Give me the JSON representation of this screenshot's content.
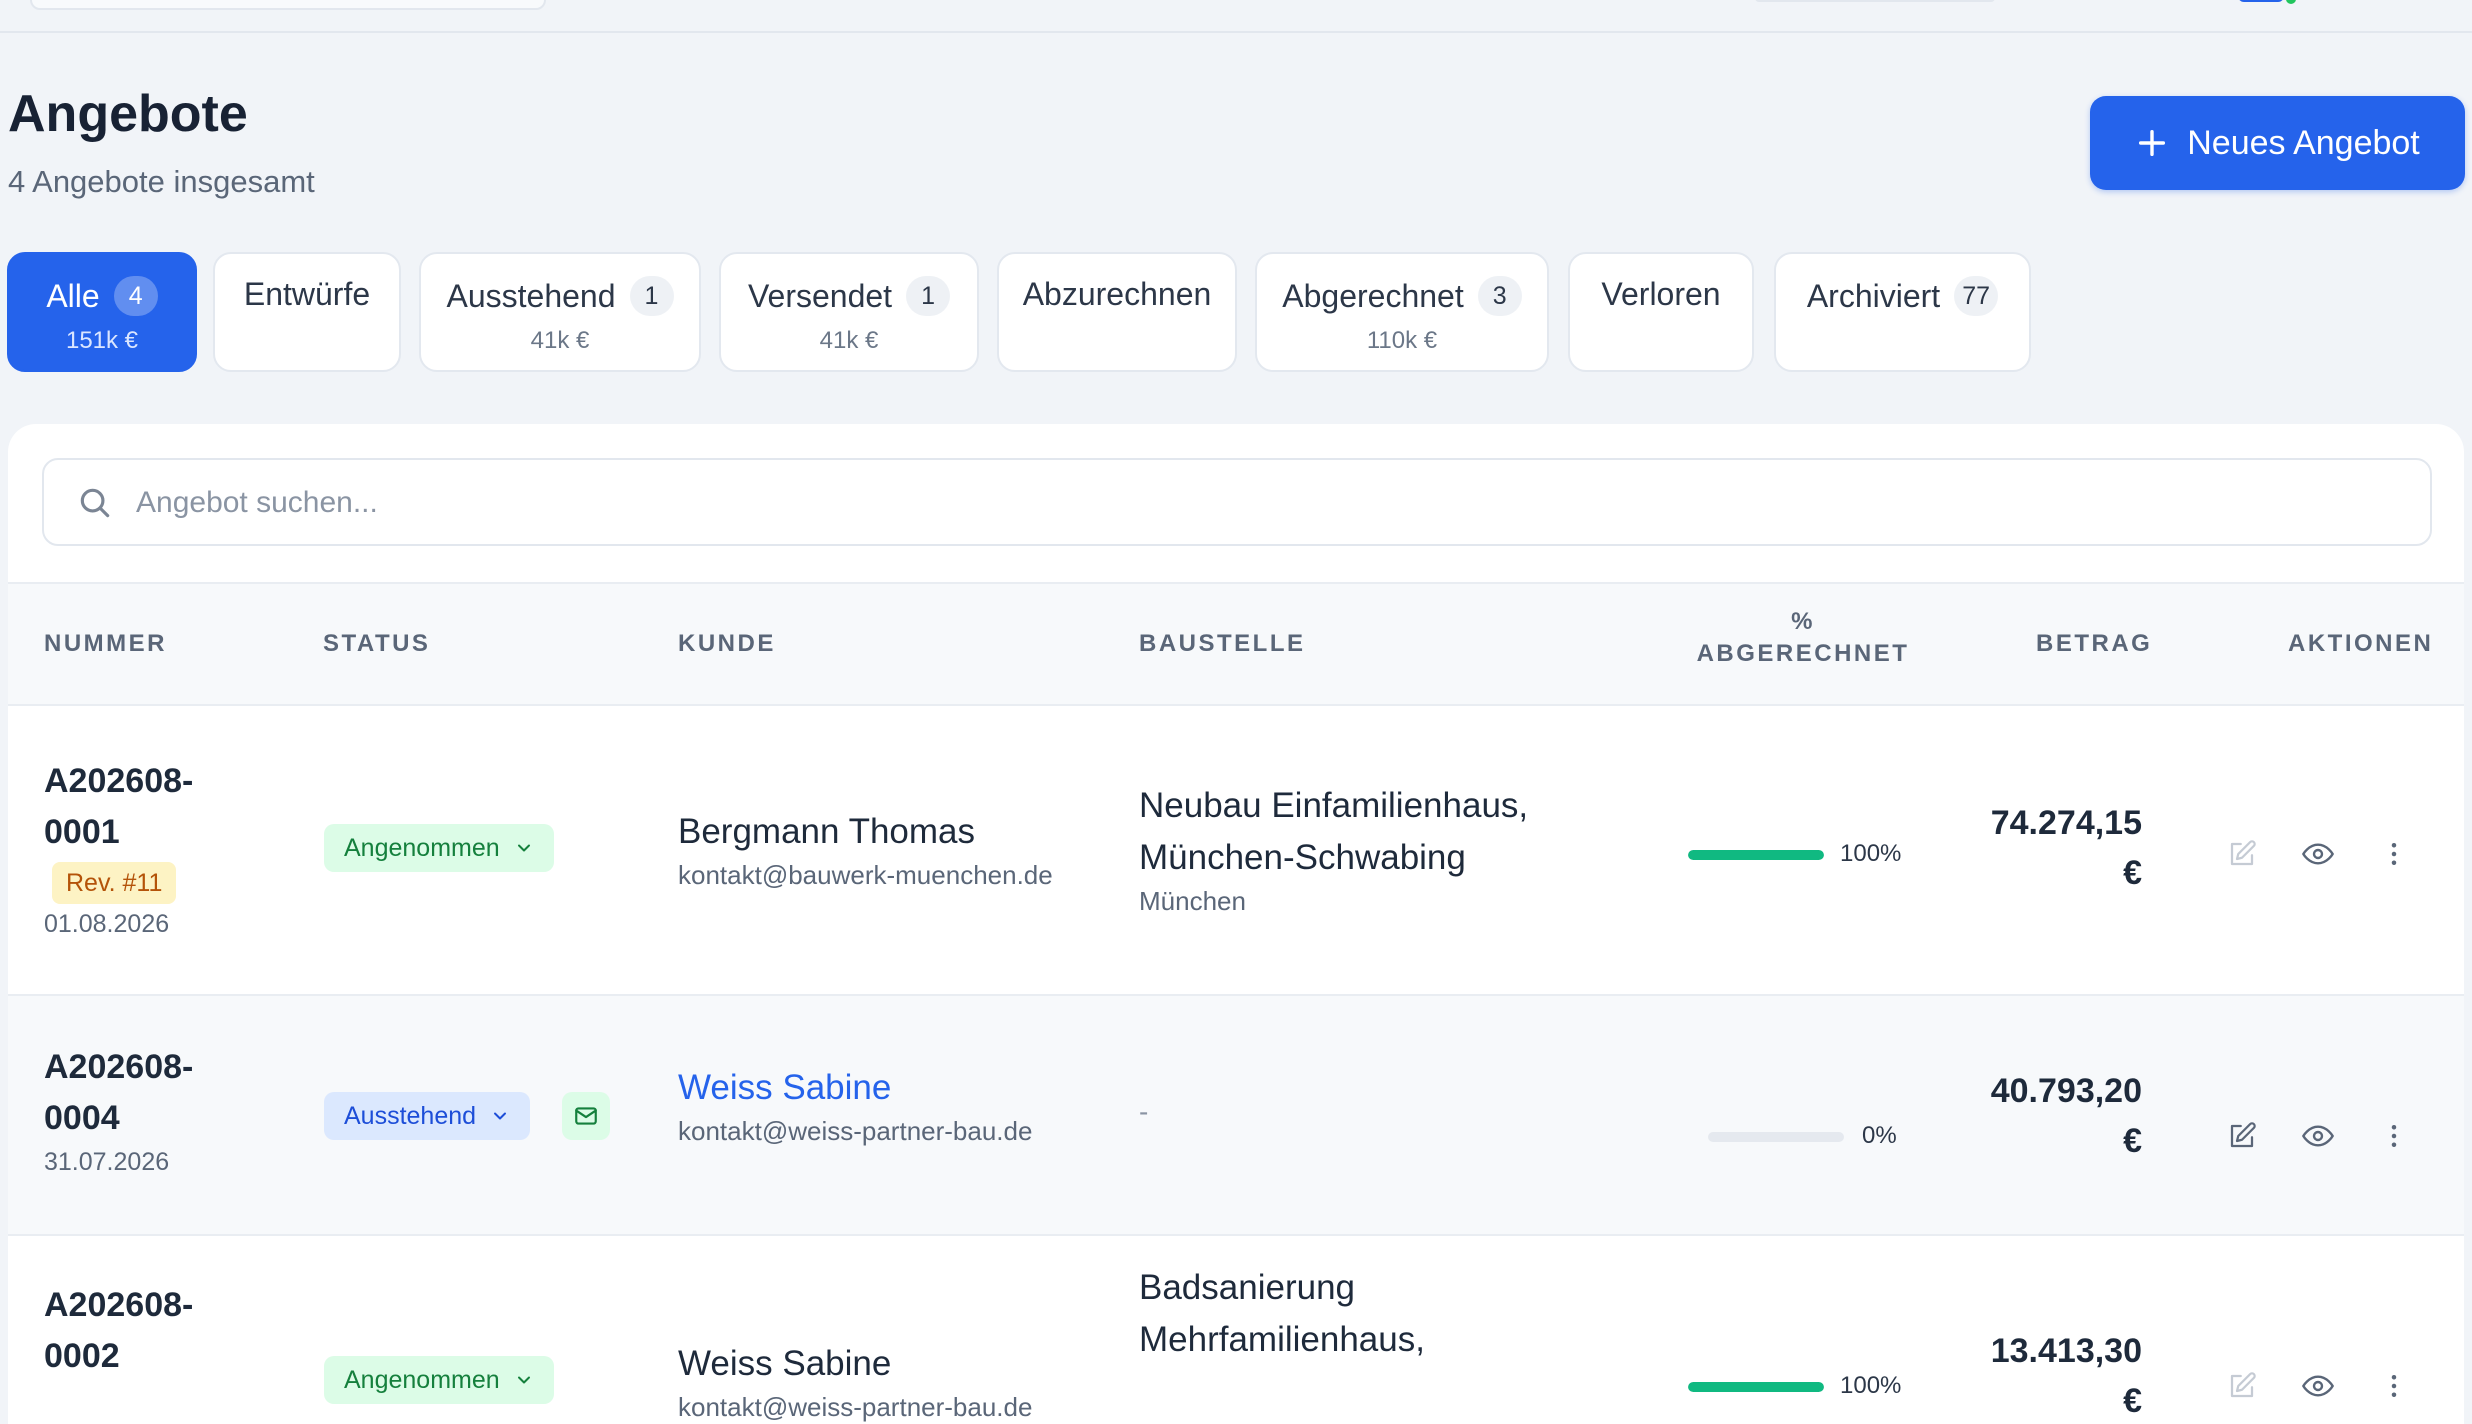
{
  "page": {
    "title": "Angebote",
    "subtitle": "4 Angebote insgesamt",
    "new_button_label": "Neues Angebot"
  },
  "tabs": [
    {
      "label": "Alle",
      "count": "4",
      "amount": "151k €",
      "active": true
    },
    {
      "label": "Entwürfe"
    },
    {
      "label": "Ausstehend",
      "count": "1",
      "amount": "41k €"
    },
    {
      "label": "Versendet",
      "count": "1",
      "amount": "41k €"
    },
    {
      "label": "Abzurechnen"
    },
    {
      "label": "Abgerechnet",
      "count": "3",
      "amount": "110k €"
    },
    {
      "label": "Verloren"
    },
    {
      "label": "Archiviert",
      "count": "77"
    }
  ],
  "search": {
    "placeholder": "Angebot suchen..."
  },
  "table": {
    "headers": {
      "number": "NUMMER",
      "status": "STATUS",
      "customer": "KUNDE",
      "site": "BAUSTELLE",
      "billed_line1": "%",
      "billed_line2": "ABGERECHNET",
      "amount": "BETRAG",
      "actions": "AKTIONEN"
    },
    "rows": [
      {
        "number_line1": "A202608-",
        "number_line2": "0001",
        "revision": "Rev. #11",
        "date": "01.08.2026",
        "status": "Angenommen",
        "customer": "Bergmann Thomas",
        "email": "kontakt@bauwerk-muenchen.de",
        "site_line1": "Neubau Einfamilienhaus,",
        "site_line2": "München-Schwabing",
        "city": "München",
        "billed_percent": 100,
        "billed_label": "100%",
        "amount_line1": "74.274,15",
        "amount_line2": "€"
      },
      {
        "number_line1": "A202608-",
        "number_line2": "0004",
        "date": "31.07.2026",
        "status": "Ausstehend",
        "customer": "Weiss Sabine",
        "email": "kontakt@weiss-partner-bau.de",
        "site_empty": "-",
        "billed_percent": 0,
        "billed_label": "0%",
        "amount_line1": "40.793,20",
        "amount_line2": "€"
      },
      {
        "number_line1": "A202608-",
        "number_line2": "0002",
        "status": "Angenommen",
        "customer": "Weiss Sabine",
        "email": "kontakt@weiss-partner-bau.de",
        "site_line1": "Badsanierung",
        "site_line2": "Mehrfamilienhaus,",
        "billed_percent": 100,
        "billed_label": "100%",
        "amount_line1": "13.413,30",
        "amount_line2": "€"
      }
    ]
  },
  "icons": {
    "add": "plus-icon",
    "search": "search-icon",
    "status_dropdown": "chevron-down-icon",
    "sent": "mail-icon",
    "edit": "edit-icon",
    "view": "eye-icon",
    "more": "more-vertical-icon"
  },
  "colors": {
    "primary": "#2563eb",
    "success": "#10b981",
    "accepted_bg": "#dcfce7",
    "accepted_text": "#15803d",
    "pending_bg": "#dbe8fe",
    "pending_text": "#1d4ed8",
    "revision_bg": "#fdf3c4",
    "revision_text": "#b45309"
  }
}
